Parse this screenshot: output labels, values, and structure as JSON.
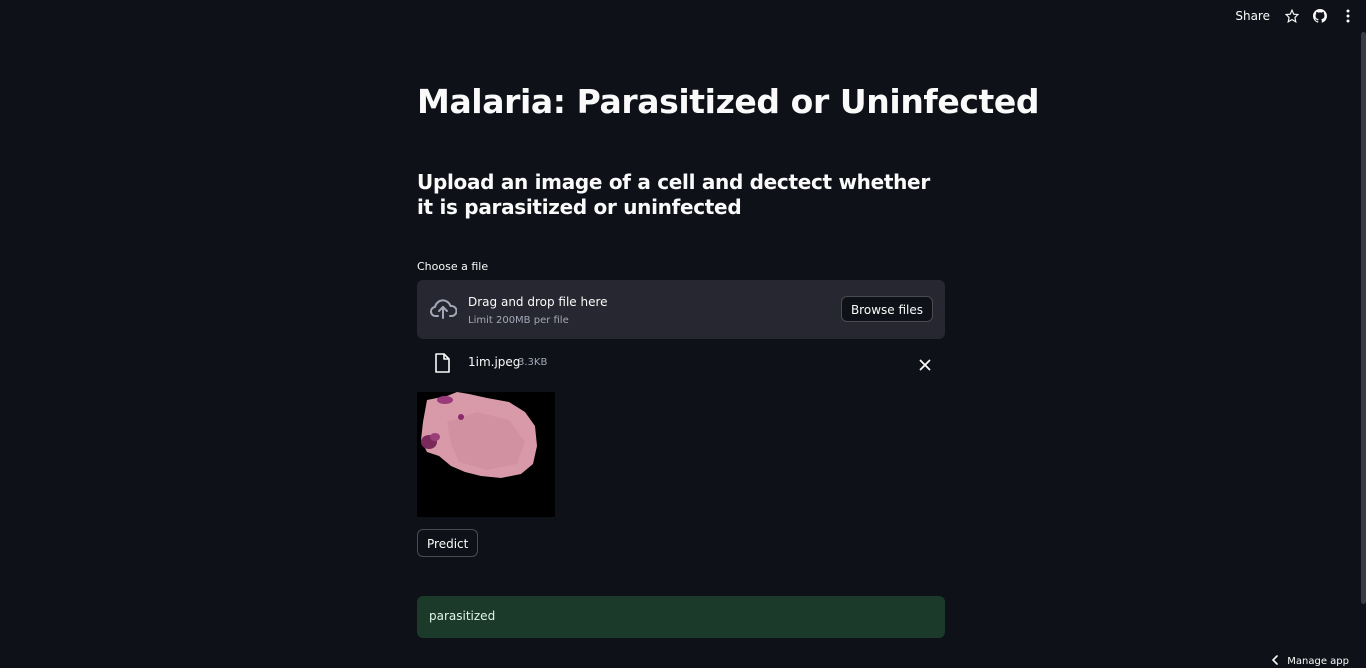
{
  "header": {
    "share_label": "Share"
  },
  "main": {
    "title": "Malaria: Parasitized or Uninfected",
    "subtitle": "Upload an image of a cell and dectect whether it is parasitized or uninfected"
  },
  "uploader": {
    "label": "Choose a file",
    "drag_text": "Drag and drop file here",
    "limit_text": "Limit 200MB per file",
    "browse_label": "Browse files",
    "file": {
      "name": "1im.jpeg",
      "size": "3.3KB"
    }
  },
  "predict": {
    "button_label": "Predict"
  },
  "result": {
    "text": "parasitized",
    "color": "#1b3a2a"
  },
  "footer": {
    "manage_label": "Manage app"
  },
  "icons": {
    "star": "star-icon",
    "github": "github-icon",
    "menu": "kebab-menu-icon",
    "upload": "cloud-upload-icon",
    "file": "file-icon",
    "close": "close-icon",
    "chevron": "chevron-left-icon"
  },
  "colors": {
    "background": "#0e1117",
    "panel": "#262730",
    "success": "#1b3a2a"
  }
}
